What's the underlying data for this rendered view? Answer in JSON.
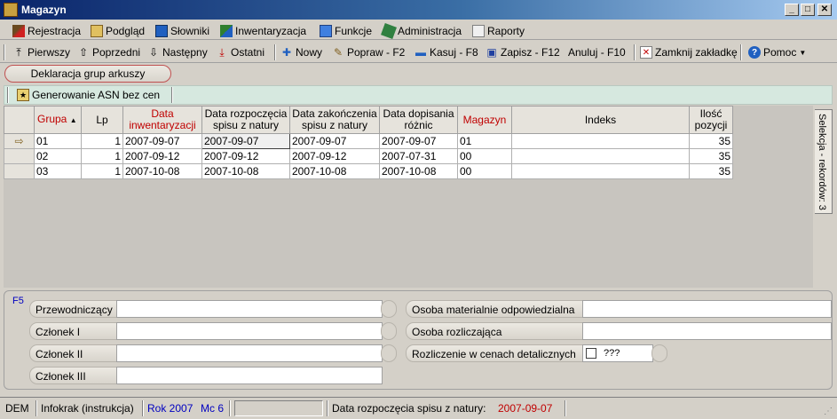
{
  "window": {
    "title": "Magazyn",
    "min_glyph": "_",
    "max_glyph": "□",
    "close_glyph": "✕"
  },
  "menu": [
    {
      "label": "Rejestracja",
      "icon": "register-icon"
    },
    {
      "label": "Podgląd",
      "icon": "preview-icon"
    },
    {
      "label": "Słowniki",
      "icon": "dictionary-icon"
    },
    {
      "label": "Inwentaryzacja",
      "icon": "inventory-icon"
    },
    {
      "label": "Funkcje",
      "icon": "functions-icon"
    },
    {
      "label": "Administracja",
      "icon": "admin-icon"
    },
    {
      "label": "Raporty",
      "icon": "reports-icon"
    }
  ],
  "toolbar": {
    "first": "Pierwszy",
    "prev": "Poprzedni",
    "next": "Następny",
    "last": "Ostatni",
    "new": "Nowy",
    "edit": "Popraw - F2",
    "delete": "Kasuj - F8",
    "save": "Zapisz - F12",
    "cancel": "Anuluj - F10",
    "close_tab": "Zamknij zakładkę",
    "help": "Pomoc"
  },
  "tab": {
    "label": "Deklaracja grup arkuszy"
  },
  "actions": {
    "generate": "Generowanie ASN bez cen"
  },
  "grid": {
    "headers": {
      "grupa": "Grupa",
      "lp": "Lp",
      "data_inw": "Data inwentaryzacji",
      "data_rozp": "Data rozpoczęcia spisu z natury",
      "data_zak": "Data zakończenia spisu z natury",
      "data_dop": "Data dopisania różnic",
      "magazyn": "Magazyn",
      "indeks": "Indeks",
      "ilosc": "Ilość pozycji"
    },
    "sort_glyph": "▲",
    "rows": [
      {
        "grupa": "01",
        "lp": "1",
        "data_inw": "2007-09-07",
        "data_rozp": "2007-09-07",
        "data_zak": "2007-09-07",
        "data_dop": "2007-09-07",
        "magazyn": "01",
        "indeks": "",
        "ilosc": "35"
      },
      {
        "grupa": "02",
        "lp": "1",
        "data_inw": "2007-09-12",
        "data_rozp": "2007-09-12",
        "data_zak": "2007-09-12",
        "data_dop": "2007-07-31",
        "magazyn": "00",
        "indeks": "",
        "ilosc": "35"
      },
      {
        "grupa": "03",
        "lp": "1",
        "data_inw": "2007-10-08",
        "data_rozp": "2007-10-08",
        "data_zak": "2007-10-08",
        "data_dop": "2007-10-08",
        "magazyn": "00",
        "indeks": "",
        "ilosc": "35"
      }
    ]
  },
  "side_tab": {
    "label": "Selekcja - rekordów: 3"
  },
  "form": {
    "hint": "F5",
    "przewodniczacy": "Przewodniczący",
    "czlonek1": "Członek I",
    "czlonek2": "Członek II",
    "czlonek3": "Członek III",
    "osoba_mat": "Osoba materialnie odpowiedzialna",
    "osoba_rozl": "Osoba rozliczająca",
    "rozliczenie": "Rozliczenie w cenach detalicznych",
    "rozliczenie_value": "???"
  },
  "status": {
    "dem": "DEM",
    "user": "Infokrak (instrukcja)",
    "rok": "Rok 2007",
    "mc": "Mc 6",
    "field_label": "Data rozpoczęcia spisu z natury:",
    "field_value": "2007-09-07"
  },
  "colors": {
    "accent_red": "#c00000",
    "accent_blue": "#0000c0",
    "action_bar": "#d6e8df"
  }
}
